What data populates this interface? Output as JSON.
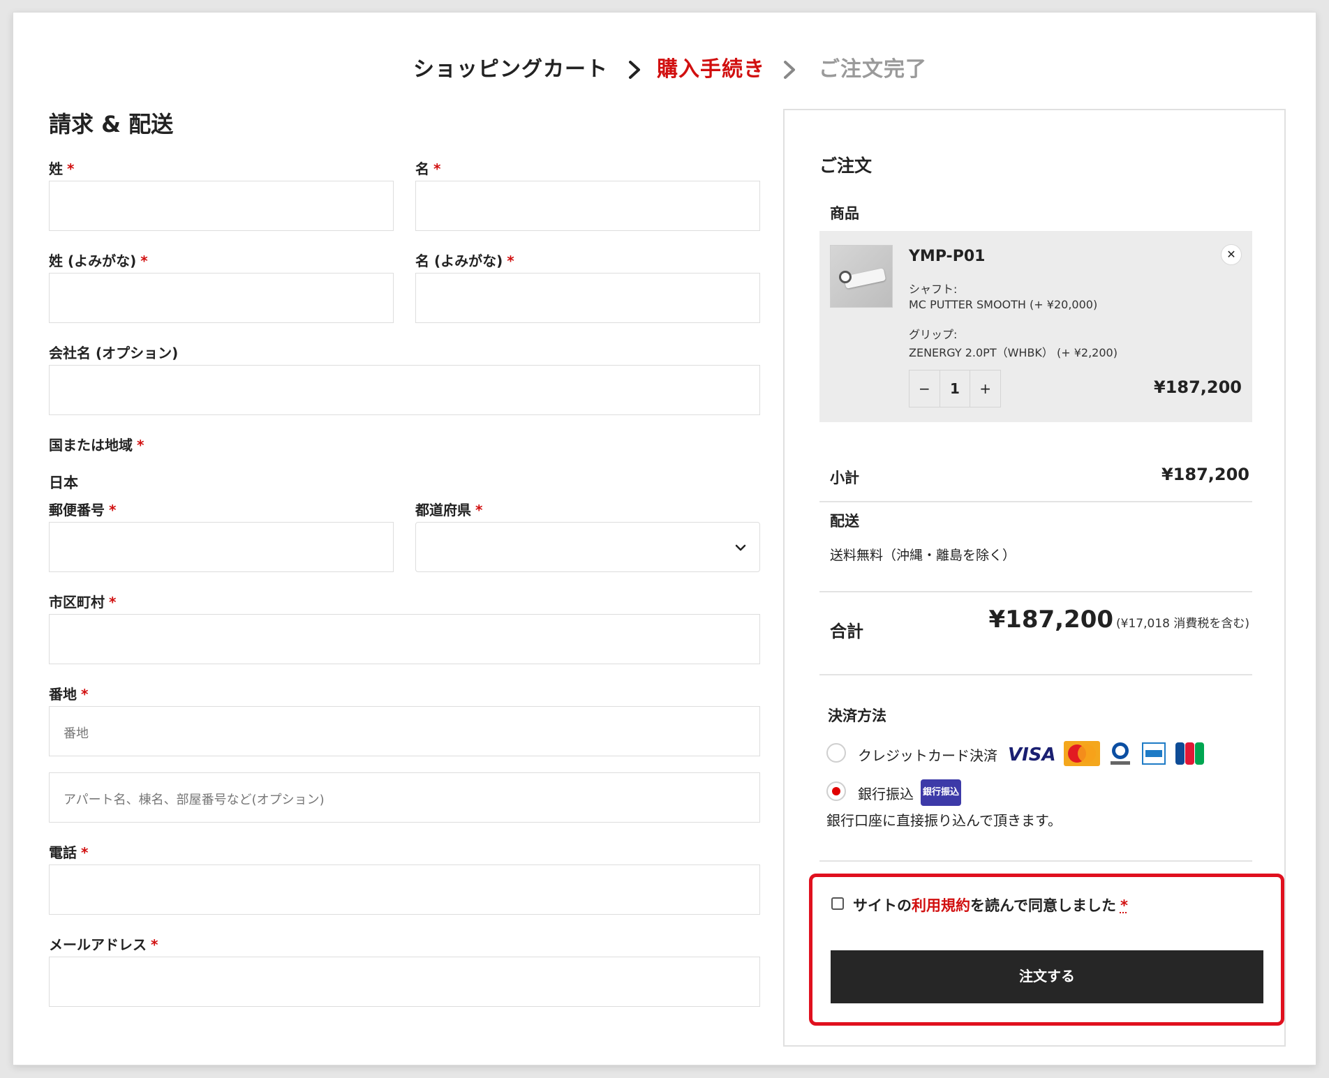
{
  "steps": [
    {
      "label": "ショッピングカート",
      "color": "#222222"
    },
    {
      "label": "購入手続き",
      "color": "#d10f0f"
    },
    {
      "label": "ご注文完了",
      "color": "#9a9a9a"
    }
  ],
  "form": {
    "title": "請求 & 配送",
    "required_mark": "*",
    "last_name_label": "姓",
    "first_name_label": "名",
    "last_name_kana_label": "姓 (よみがな)",
    "first_name_kana_label": "名 (よみがな)",
    "company_label": "会社名 (オプション)",
    "country_label": "国または地域",
    "country_value": "日本",
    "postal_label": "郵便番号",
    "prefecture_label": "都道府県",
    "city_label": "市区町村",
    "address_label": "番地",
    "address_placeholder": "番地",
    "address2_placeholder": "アパート名、棟名、部屋番号など(オプション)",
    "phone_label": "電話",
    "email_label": "メールアドレス"
  },
  "order": {
    "title": "ご注文",
    "products_label": "商品",
    "item": {
      "name": "YMP-P01",
      "shaft_label": "シャフト:",
      "shaft_value": "MC PUTTER SMOOTH (+ ¥20,000)",
      "grip_label": "グリップ:",
      "grip_value": "ZENERGY 2.0PT（WHBK） (+ ¥2,200)",
      "quantity": "1",
      "minus": "−",
      "plus": "+",
      "remove": "✕",
      "price": "¥187,200"
    },
    "subtotal_label": "小計",
    "subtotal_value": "¥187,200",
    "shipping_label": "配送",
    "shipping_value": "送料無料（沖縄・離島を除く）",
    "total_label": "合計",
    "total_value": "¥187,200",
    "tax_note": "(¥17,018 消費税を含む)",
    "payment_label": "決済方法",
    "payment_methods": [
      {
        "label": "クレジットカード決済",
        "selected": false,
        "logos": [
          "VISA",
          "MasterCard",
          "Diners Club",
          "AMEX",
          "JCB"
        ]
      },
      {
        "label": "銀行振込",
        "selected": true,
        "badge": "銀行振込"
      }
    ],
    "bank_description": "銀行口座に直接振り込んで頂きます。",
    "terms_prefix": "サイトの",
    "terms_link": "利用規約",
    "terms_suffix": "を読んで同意しました",
    "terms_required": "*",
    "submit_label": "注文する",
    "accent_color": "#e0101e"
  }
}
